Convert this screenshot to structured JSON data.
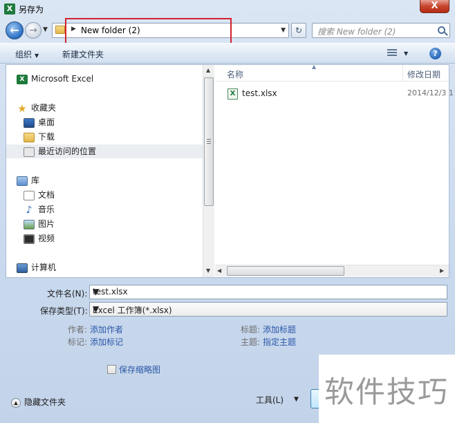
{
  "window": {
    "app_icon": "X",
    "title": "另存为",
    "close_label": "X"
  },
  "navbar": {
    "back_icon": "back-arrow-icon",
    "forward_icon": "forward-arrow-icon",
    "address_path": "New folder (2)",
    "search_placeholder": "搜索 New folder (2)"
  },
  "toolbar": {
    "organize_label": "组织",
    "new_folder_label": "新建文件夹"
  },
  "nav_pane": {
    "items": [
      {
        "label": "Microsoft Excel",
        "icon": "excel-icon"
      },
      {
        "label": "收藏夹",
        "icon": "star-icon"
      },
      {
        "label": "桌面",
        "icon": "desktop-icon"
      },
      {
        "label": "下载",
        "icon": "download-folder-icon"
      },
      {
        "label": "最近访问的位置",
        "icon": "recent-places-icon"
      },
      {
        "label": "库",
        "icon": "library-icon"
      },
      {
        "label": "文档",
        "icon": "documents-icon"
      },
      {
        "label": "音乐",
        "icon": "music-icon"
      },
      {
        "label": "图片",
        "icon": "pictures-icon"
      },
      {
        "label": "视频",
        "icon": "videos-icon"
      },
      {
        "label": "计算机",
        "icon": "computer-icon"
      }
    ]
  },
  "file_list": {
    "columns": {
      "name": "名称",
      "date": "修改日期"
    },
    "files": [
      {
        "name": "test.xlsx",
        "date": "2014/12/3 1"
      }
    ]
  },
  "form": {
    "filename_label": "文件名(N):",
    "filename_value": "test.xlsx",
    "filetype_label": "保存类型(T):",
    "filetype_value": "Excel 工作簿(*.xlsx)",
    "author_label": "作者:",
    "author_link": "添加作者",
    "tags_label": "标记:",
    "tags_link": "添加标记",
    "title_label": "标题:",
    "title_link": "添加标题",
    "subject_label": "主题:",
    "subject_link": "指定主题",
    "thumbnail_label": "保存缩略图"
  },
  "footer": {
    "hide_folders_label": "隐藏文件夹",
    "tools_label": "工具(L)"
  },
  "watermark": {
    "text": "软件技巧"
  }
}
